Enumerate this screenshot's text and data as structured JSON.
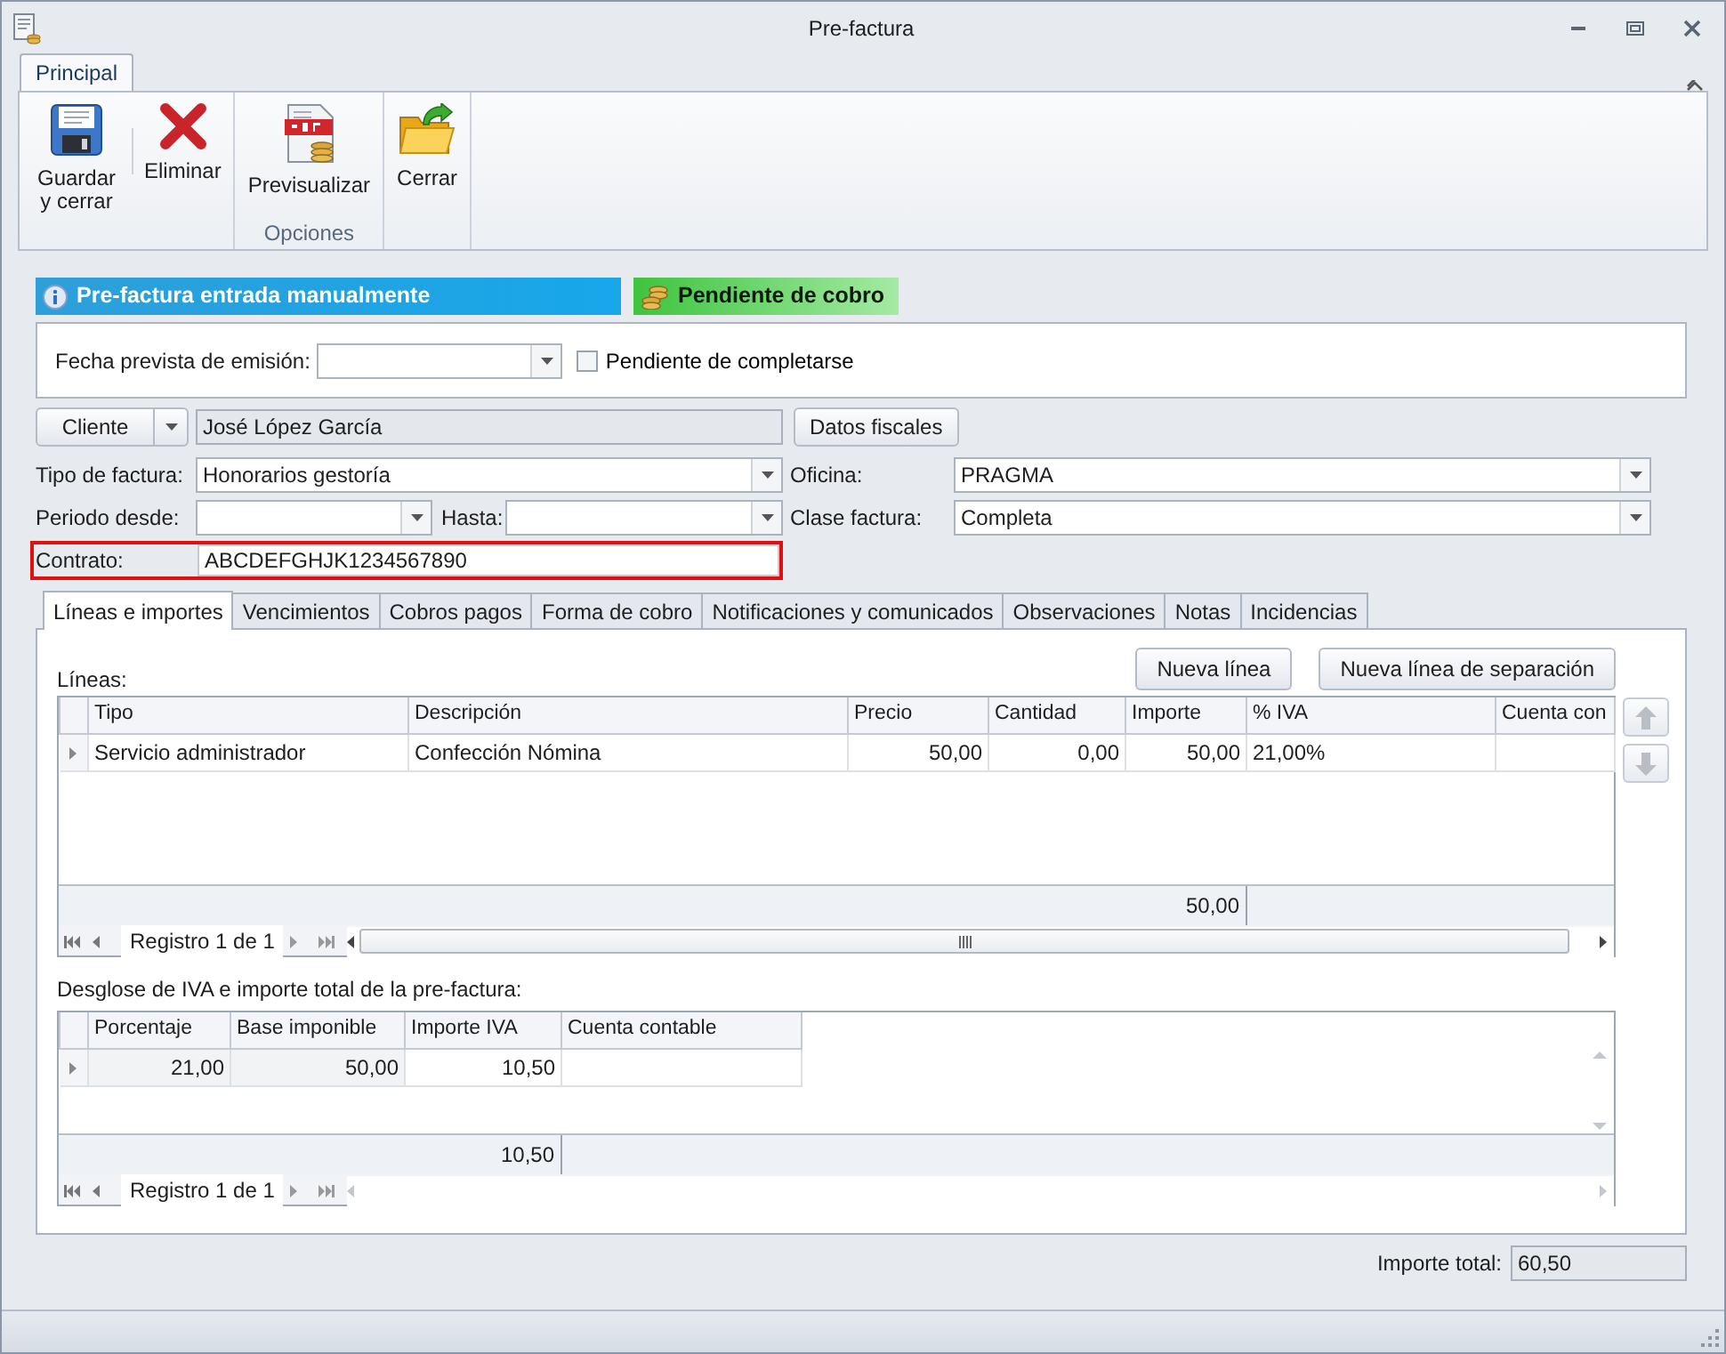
{
  "window": {
    "title": "Pre-factura"
  },
  "ribbon": {
    "tabs": [
      {
        "label": "Principal",
        "selected": true
      }
    ],
    "groups": [
      {
        "buttons": [
          {
            "label": "Guardar y cerrar",
            "kind": "save"
          },
          {
            "label": "Eliminar",
            "kind": "delete"
          }
        ]
      },
      {
        "label": "Opciones",
        "buttons": [
          {
            "label": "Previsualizar",
            "kind": "pdf"
          }
        ]
      },
      {
        "buttons": [
          {
            "label": "Cerrar",
            "kind": "close"
          }
        ]
      }
    ]
  },
  "banners": [
    {
      "text": "Pre-factura entrada manualmente",
      "kind": "info"
    },
    {
      "text": "Pendiente de cobro",
      "kind": "payment"
    }
  ],
  "emission": {
    "label": "Fecha prevista de emisión:",
    "checkbox": {
      "label": "Pendiente de completarse",
      "checked": false
    }
  },
  "client": {
    "button": "Cliente",
    "name": "José López García",
    "fiscal_button": "Datos fiscales"
  },
  "tipo_factura": {
    "label": "Tipo de factura:",
    "value": "Honorarios gestoría"
  },
  "oficina": {
    "label": "Oficina:",
    "value": "PRAGMA"
  },
  "periodo_desde": {
    "label": "Periodo desde:"
  },
  "hasta": {
    "label": "Hasta:"
  },
  "clase_factura": {
    "label": "Clase factura:",
    "value": "Completa"
  },
  "contrato": {
    "label": "Contrato:",
    "value": "ABCDEFGHJK1234567890",
    "highlighted": true
  },
  "tabs": [
    {
      "label": "Líneas e importes",
      "selected": true
    },
    {
      "label": "Vencimientos",
      "selected": false
    },
    {
      "label": "Cobros pagos",
      "selected": false
    },
    {
      "label": "Forma de cobro",
      "selected": false
    },
    {
      "label": "Notificaciones y comunicados",
      "selected": false
    },
    {
      "label": "Observaciones",
      "selected": false
    },
    {
      "label": "Notas",
      "selected": false
    },
    {
      "label": "Incidencias",
      "selected": false
    }
  ],
  "lineas": {
    "label": "Líneas:",
    "buttons": [
      "Nueva línea",
      "Nueva línea de separación"
    ],
    "columns": [
      {
        "label": "Tipo",
        "kind": "text"
      },
      {
        "label": "Descripción",
        "kind": "text"
      },
      {
        "label": "Precio",
        "kind": "number"
      },
      {
        "label": "Cantidad",
        "kind": "number"
      },
      {
        "label": "Importe",
        "kind": "number",
        "total": "50,00"
      },
      {
        "label": "% IVA",
        "kind": "text"
      },
      {
        "label": "Cuenta con",
        "kind": "text"
      }
    ],
    "rows": [
      {
        "current": true,
        "cells": [
          "Servicio administrador",
          "Confección Nómina",
          "50,00",
          "0,00",
          "50,00",
          "21,00%"
        ]
      }
    ],
    "navigator": "Registro 1 de 1"
  },
  "desglose": {
    "label": "Desglose de IVA e importe total de la pre-factura:",
    "columns": [
      {
        "label": "Porcentaje",
        "kind": "number",
        "readonly": true
      },
      {
        "label": "Base imponible",
        "kind": "number",
        "readonly": true
      },
      {
        "label": "Importe IVA",
        "kind": "number",
        "readonly": false,
        "total": "10,50"
      },
      {
        "label": "Cuenta contable",
        "kind": "text",
        "readonly": false
      }
    ],
    "rows": [
      {
        "current": true,
        "cells": [
          "21,00",
          "50,00",
          "10,50"
        ]
      }
    ],
    "navigator": "Registro 1 de 1"
  },
  "importe_total": {
    "label": "Importe total:",
    "value": "60,50"
  }
}
